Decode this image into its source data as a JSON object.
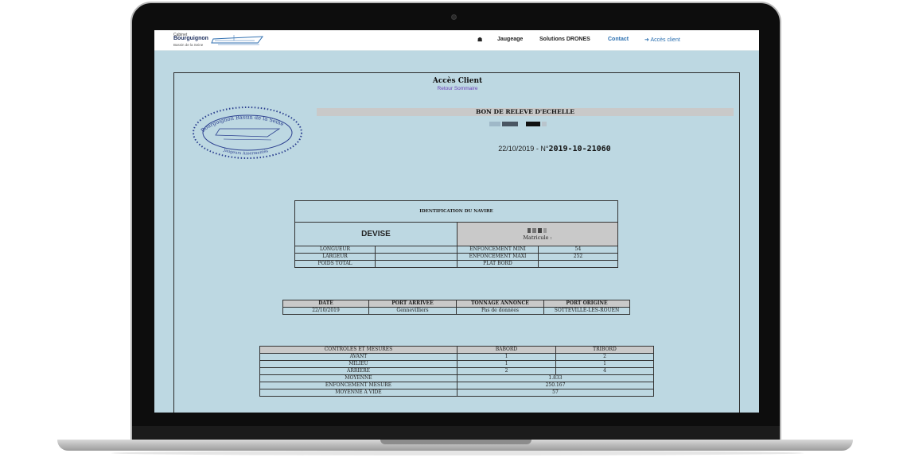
{
  "header": {
    "logo": {
      "line1": "Cabinet",
      "line2": "Bourguignon",
      "line3": "Bassin de la Seine"
    },
    "nav": [
      {
        "label": "Jaugeage"
      },
      {
        "label": "Solutions DRONES"
      },
      {
        "label": "Contact"
      },
      {
        "label": "Accès client"
      }
    ]
  },
  "page": {
    "title": "Accès Client",
    "back_link": "Retour Sommaire",
    "stamp": {
      "top_text": "Bourguignon Bassin de la Seine",
      "bottom_text": "Jaugeurs Assermentés"
    },
    "document_title": "BON DE RELEVE D'ECHELLE",
    "date": "22/10/2019",
    "number_prefix": "- N°",
    "number": "2019-10-21060"
  },
  "identification": {
    "header": "IDENTIFICATION DU NAVIRE",
    "name": "DEVISE",
    "matricule_label": "Matricule :",
    "rows": [
      {
        "label": "LONGUEUR",
        "value": "",
        "label2": "ENFONCEMENT MINI",
        "value2": "54"
      },
      {
        "label": "LARGEUR",
        "value": "",
        "label2": "ENFONCEMENT MAXI",
        "value2": "252"
      },
      {
        "label": "POIDS TOTAL",
        "value": "",
        "label2": "PLAT BORD",
        "value2": ""
      }
    ]
  },
  "voyage": {
    "headers": [
      "DATE",
      "PORT ARRIVEE",
      "TONNAGE ANNONCE",
      "PORT ORIGINE"
    ],
    "values": [
      "22/10/2019",
      "Gennevilliers",
      "Pas de données",
      "SOTTEVILLE-LES-ROUEN"
    ]
  },
  "mesures": {
    "headers": [
      "CONTROLES ET MESURES",
      "BABORD",
      "TRIBORD"
    ],
    "rows": [
      {
        "label": "AVANT",
        "babord": "1",
        "tribord": "2"
      },
      {
        "label": "MILIEU",
        "babord": "1",
        "tribord": "1"
      },
      {
        "label": "ARRIERE",
        "babord": "2",
        "tribord": "4"
      }
    ],
    "moyenne_label": "MOYENNE",
    "moyenne": "1.833",
    "enfoncement_label": "ENFONCEMENT MESURE",
    "enfoncement": "250.167",
    "vide_label": "MOYENNE A VIDE",
    "vide": "57"
  },
  "colors": {
    "page_bg": "#bdd8e2",
    "header_cell": "#c9c9c9",
    "link": "#2a6fb0",
    "back_link": "#6a3fb8",
    "stamp": "#2b3f8f"
  },
  "icons": {
    "home": "home-icon",
    "login": "sign-in-icon"
  }
}
